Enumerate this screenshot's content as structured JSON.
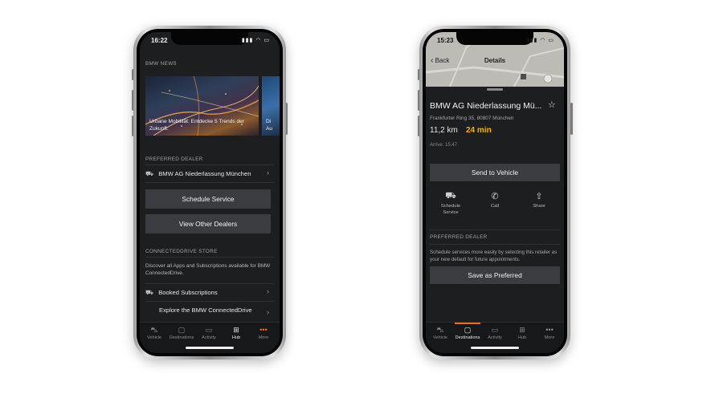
{
  "left_phone": {
    "status_time": "16:22",
    "status_icons": "▮▮▮ ◠ ▭",
    "news": {
      "label": "BMW NEWS",
      "card1_caption": "Urbane Mobilität: Entdecke 5 Trends der Zukunft.",
      "card2_caption": "Di Au"
    },
    "preferred_dealer": {
      "label": "PREFERRED DEALER",
      "dealer_name": "BMW AG Niederlassung München",
      "schedule_button": "Schedule Service",
      "other_dealers_button": "View Other Dealers"
    },
    "store": {
      "label": "CONNECTEDDRIVE STORE",
      "description": "Discover all Apps and Subscriptions available for BMW ConnectedDrive.",
      "booked": "Booked Subscriptions",
      "explore": "Explore the BMW ConnectedDrive"
    },
    "tabs": [
      {
        "label": "Vehicle",
        "icon": "car-icon"
      },
      {
        "label": "Destinations",
        "icon": "chat-icon"
      },
      {
        "label": "Activity",
        "icon": "calendar-icon"
      },
      {
        "label": "Hub",
        "icon": "grid-icon"
      },
      {
        "label": "More",
        "icon": "more-icon"
      }
    ],
    "active_tab": "Hub"
  },
  "right_phone": {
    "status_time": "15:23",
    "status_icons": "▮▮▮ ◠ ▭",
    "nav": {
      "back_label": "Back",
      "title": "Details"
    },
    "destination": {
      "name": "BMW AG Niederlassung Mü...",
      "address": "Frankfurter Ring 35, 80807 München",
      "distance": "11,2 km",
      "duration": "24 min",
      "arrival": "Arrive: 15:47"
    },
    "send_button": "Send to Vehicle",
    "actions": [
      {
        "label": "Schedule Service",
        "icon": "service-car-icon"
      },
      {
        "label": "Call",
        "icon": "phone-icon"
      },
      {
        "label": "Share",
        "icon": "share-icon"
      }
    ],
    "preferred_dealer": {
      "label": "PREFERRED DEALER",
      "description": "Schedule services more easily by selecting this retailer as your new default for future appointments.",
      "save_button": "Save as Preferred"
    },
    "tabs": [
      {
        "label": "Vehicle",
        "icon": "car-icon"
      },
      {
        "label": "Destinations",
        "icon": "chat-icon"
      },
      {
        "label": "Activity",
        "icon": "calendar-icon"
      },
      {
        "label": "Hub",
        "icon": "grid-icon"
      },
      {
        "label": "More",
        "icon": "more-icon"
      }
    ],
    "active_tab": "Destinations"
  },
  "colors": {
    "accent": "#ff6a1a",
    "duration": "#f5b400",
    "screen_bg": "#1d1e20",
    "button_bg": "#3b3c3f"
  }
}
